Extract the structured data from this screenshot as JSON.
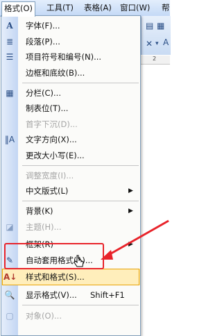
{
  "menubar": {
    "items": [
      {
        "label": "格式(O)",
        "active": true
      },
      {
        "label": "工具(T)"
      },
      {
        "label": "表格(A)"
      },
      {
        "label": "窗口(W)"
      },
      {
        "label": "帮"
      }
    ]
  },
  "toolbar": {
    "ruler_number": "2"
  },
  "menu": {
    "items": [
      {
        "icon": "font-icon",
        "label": "字体(F)...",
        "disabled": false
      },
      {
        "icon": "paragraph-icon",
        "label": "段落(P)...",
        "disabled": false
      },
      {
        "icon": "bullets-numbering-icon",
        "label": "项目符号和编号(N)...",
        "disabled": false
      },
      {
        "icon": "",
        "label": "边框和底纹(B)...",
        "disabled": false
      },
      {
        "icon": "columns-icon",
        "label": "分栏(C)...",
        "disabled": false
      },
      {
        "icon": "",
        "label": "制表位(T)...",
        "disabled": false
      },
      {
        "icon": "",
        "label": "首字下沉(D)...",
        "disabled": true
      },
      {
        "icon": "text-direction-icon",
        "label": "文字方向(X)...",
        "disabled": false
      },
      {
        "icon": "",
        "label": "更改大小写(E)...",
        "disabled": false
      },
      {
        "icon": "",
        "label": "调整宽度(I)...",
        "disabled": true
      },
      {
        "icon": "",
        "label": "中文版式(L)",
        "disabled": false,
        "submenu": true
      },
      {
        "icon": "",
        "label": "背景(K)",
        "disabled": false,
        "submenu": true
      },
      {
        "icon": "theme-icon",
        "label": "主题(H)...",
        "disabled": true
      },
      {
        "icon": "",
        "label": "框架(R)",
        "disabled": false,
        "submenu": true
      },
      {
        "icon": "autoformat-icon",
        "label": "自动套用格式(A)...",
        "disabled": false
      },
      {
        "icon": "styles-formatting-icon",
        "label": "样式和格式(S)...",
        "disabled": false,
        "hover": true
      },
      {
        "icon": "reveal-formatting-icon",
        "label": "显示格式(V)...",
        "shortcut": "Shift+F1",
        "disabled": false
      },
      {
        "icon": "object-icon",
        "label": "对象(O)...",
        "disabled": true
      }
    ]
  },
  "annotation": {
    "color": "#e8232a"
  }
}
